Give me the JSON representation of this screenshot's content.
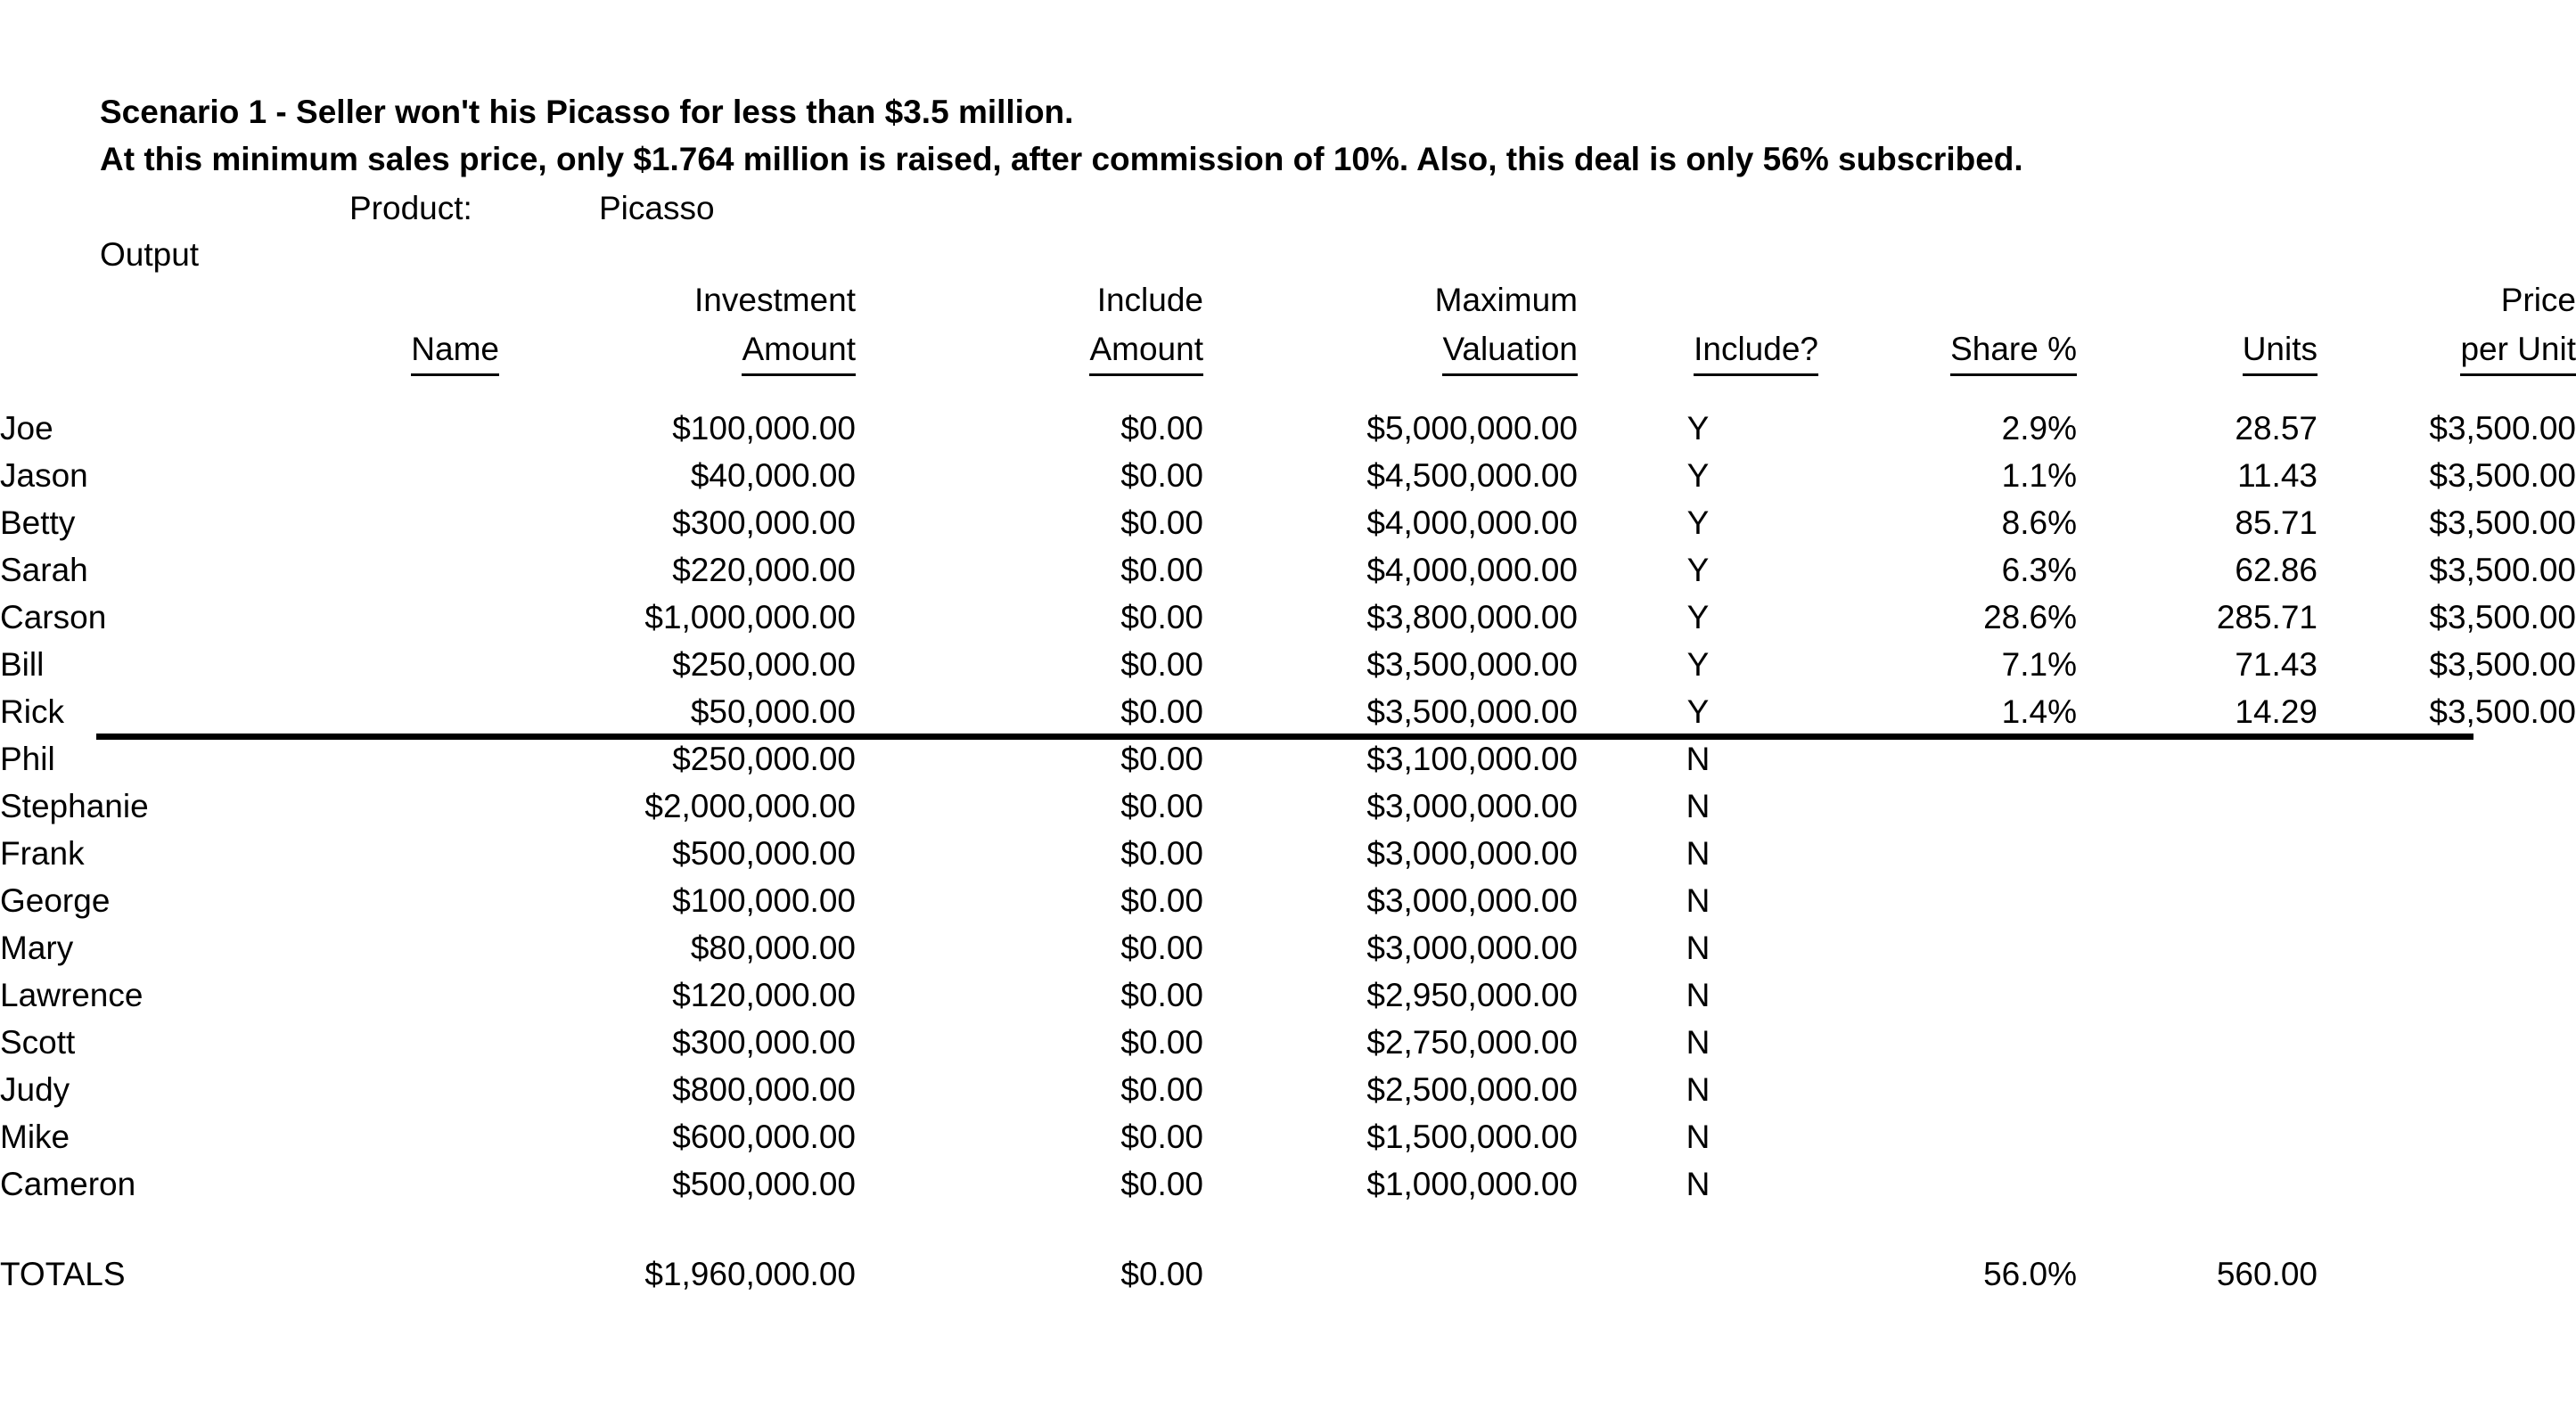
{
  "headline": {
    "line1": "Scenario 1 - Seller won't his Picasso for less than $3.5 million.",
    "line2": "At this minimum sales price, only $1.764 million is raised, after commission of 10%.  Also, this deal is only 56% subscribed."
  },
  "meta": {
    "product_label": "Product:",
    "product_value": "Picasso",
    "output_label": "Output"
  },
  "table": {
    "headers_top": [
      "",
      "Investment",
      "Include",
      "Maximum",
      "",
      "",
      "",
      "Price"
    ],
    "headers_bottom": [
      "Name",
      "Amount",
      "Amount",
      "Valuation",
      "Include?",
      "Share %",
      "Units",
      "per Unit"
    ],
    "rows": [
      {
        "name": "Joe",
        "investment": "$100,000.00",
        "include_amount": "$0.00",
        "max_valuation": "$5,000,000.00",
        "include": "Y",
        "share": "2.9%",
        "units": "28.57",
        "price": "$3,500.00"
      },
      {
        "name": "Jason",
        "investment": "$40,000.00",
        "include_amount": "$0.00",
        "max_valuation": "$4,500,000.00",
        "include": "Y",
        "share": "1.1%",
        "units": "11.43",
        "price": "$3,500.00"
      },
      {
        "name": "Betty",
        "investment": "$300,000.00",
        "include_amount": "$0.00",
        "max_valuation": "$4,000,000.00",
        "include": "Y",
        "share": "8.6%",
        "units": "85.71",
        "price": "$3,500.00"
      },
      {
        "name": "Sarah",
        "investment": "$220,000.00",
        "include_amount": "$0.00",
        "max_valuation": "$4,000,000.00",
        "include": "Y",
        "share": "6.3%",
        "units": "62.86",
        "price": "$3,500.00"
      },
      {
        "name": "Carson",
        "investment": "$1,000,000.00",
        "include_amount": "$0.00",
        "max_valuation": "$3,800,000.00",
        "include": "Y",
        "share": "28.6%",
        "units": "285.71",
        "price": "$3,500.00"
      },
      {
        "name": "Bill",
        "investment": "$250,000.00",
        "include_amount": "$0.00",
        "max_valuation": "$3,500,000.00",
        "include": "Y",
        "share": "7.1%",
        "units": "71.43",
        "price": "$3,500.00"
      },
      {
        "name": "Rick",
        "investment": "$50,000.00",
        "include_amount": "$0.00",
        "max_valuation": "$3,500,000.00",
        "include": "Y",
        "share": "1.4%",
        "units": "14.29",
        "price": "$3,500.00"
      },
      {
        "name": "Phil",
        "investment": "$250,000.00",
        "include_amount": "$0.00",
        "max_valuation": "$3,100,000.00",
        "include": "N",
        "share": "",
        "units": "",
        "price": ""
      },
      {
        "name": "Stephanie",
        "investment": "$2,000,000.00",
        "include_amount": "$0.00",
        "max_valuation": "$3,000,000.00",
        "include": "N",
        "share": "",
        "units": "",
        "price": ""
      },
      {
        "name": "Frank",
        "investment": "$500,000.00",
        "include_amount": "$0.00",
        "max_valuation": "$3,000,000.00",
        "include": "N",
        "share": "",
        "units": "",
        "price": ""
      },
      {
        "name": "George",
        "investment": "$100,000.00",
        "include_amount": "$0.00",
        "max_valuation": "$3,000,000.00",
        "include": "N",
        "share": "",
        "units": "",
        "price": ""
      },
      {
        "name": "Mary",
        "investment": "$80,000.00",
        "include_amount": "$0.00",
        "max_valuation": "$3,000,000.00",
        "include": "N",
        "share": "",
        "units": "",
        "price": ""
      },
      {
        "name": "Lawrence",
        "investment": "$120,000.00",
        "include_amount": "$0.00",
        "max_valuation": "$2,950,000.00",
        "include": "N",
        "share": "",
        "units": "",
        "price": ""
      },
      {
        "name": "Scott",
        "investment": "$300,000.00",
        "include_amount": "$0.00",
        "max_valuation": "$2,750,000.00",
        "include": "N",
        "share": "",
        "units": "",
        "price": ""
      },
      {
        "name": "Judy",
        "investment": "$800,000.00",
        "include_amount": "$0.00",
        "max_valuation": "$2,500,000.00",
        "include": "N",
        "share": "",
        "units": "",
        "price": ""
      },
      {
        "name": "Mike",
        "investment": "$600,000.00",
        "include_amount": "$0.00",
        "max_valuation": "$1,500,000.00",
        "include": "N",
        "share": "",
        "units": "",
        "price": ""
      },
      {
        "name": "Cameron",
        "investment": "$500,000.00",
        "include_amount": "$0.00",
        "max_valuation": "$1,000,000.00",
        "include": "N",
        "share": "",
        "units": "",
        "price": ""
      }
    ],
    "cutoff_after_row_index": 6,
    "totals": {
      "label": "TOTALS",
      "investment": "$1,960,000.00",
      "include_amount": "$0.00",
      "max_valuation": "",
      "include": "",
      "share": "56.0%",
      "units": "560.00",
      "price": ""
    }
  }
}
